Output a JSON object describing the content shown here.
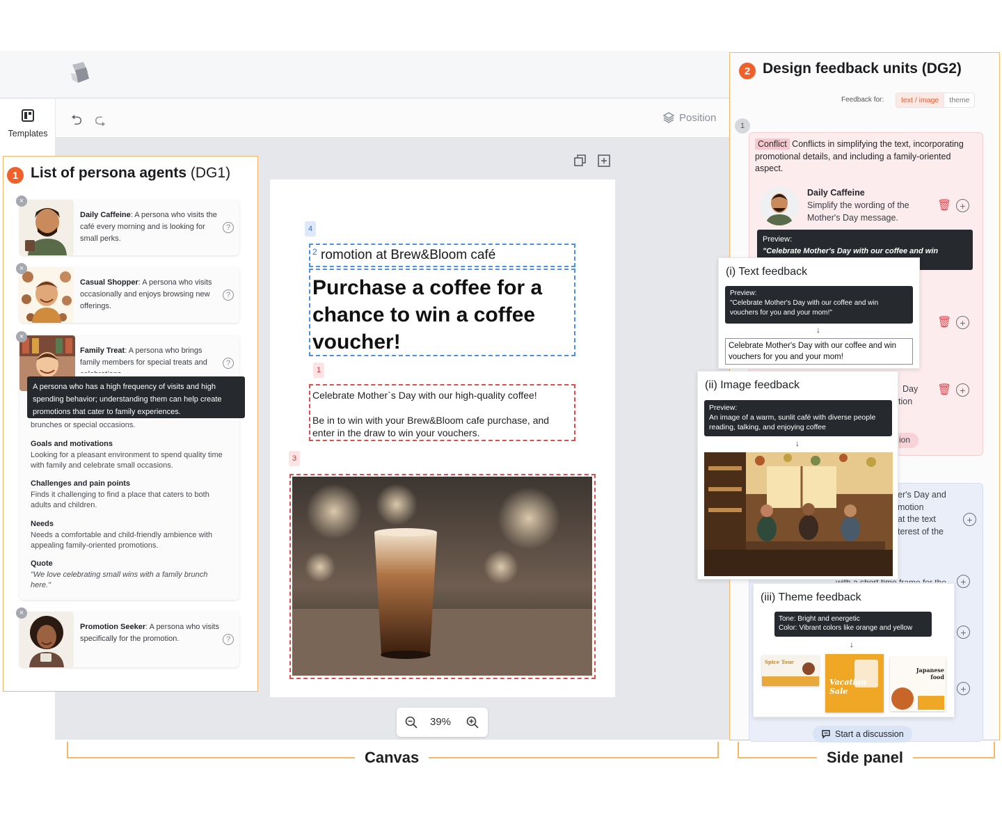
{
  "left_rail": {
    "templates_label": "Templates"
  },
  "toolbar": {
    "position_label": "Position"
  },
  "personas_panel": {
    "number": "1",
    "title": "List of persona agents",
    "title_suffix": "(DG1)",
    "personas": [
      {
        "name": "Daily Caffeine",
        "desc_lines": [
          "A persona who",
          "visits the café every morning and is",
          "looking for small perks."
        ]
      },
      {
        "name": "Casual Shopper",
        "desc_lines": [
          "A persona who",
          "visits occasionally and enjoys",
          "browsing new offerings."
        ]
      },
      {
        "name": "Family Treat",
        "desc_lines": [
          "A persona who",
          "brings family members for special",
          "treats and celebrations."
        ]
      },
      {
        "name": "Promotion Seeker",
        "desc_lines": [
          "A persona who",
          "visits specifically for the",
          "promotion."
        ]
      }
    ],
    "tooltip": "A persona who has a high frequency of visits and high spending behavior; understanding them can help create promotions that cater to family experiences.",
    "detail": {
      "intro_tail": "brunches or special occasions.",
      "sections": [
        {
          "heading": "Goals and motivations",
          "text": "Looking for a pleasant environment to spend quality time with family and celebrate small occasions."
        },
        {
          "heading": "Challenges and pain points",
          "text": "Finds it challenging to find a place that caters to both adults and children."
        },
        {
          "heading": "Needs",
          "text": "Needs a comfortable and child-friendly ambience with appealing family-oriented promotions."
        },
        {
          "heading": "Quote",
          "text": "\"We love celebrating small wins with a family brunch here.\""
        }
      ]
    }
  },
  "canvas": {
    "tags": {
      "t4": "4",
      "t2": "2",
      "t1": "1",
      "t3": "3"
    },
    "subtitle": "romotion at Brew&Bloom café",
    "headline": "Purchase a coffee for a chance to win a coffee voucher!",
    "body_line1": "Celebrate Mother`s Day with our high-quality coffee!",
    "body_line2": "Be in to win with your Brew&Bloom cafe purchase, and enter in the draw to win your vouchers.",
    "zoom": "39%"
  },
  "side_panel": {
    "number": "2",
    "title": "Design feedback units (DG2)",
    "feedback_for_label": "Feedback for:",
    "seg_options": [
      "text / image",
      "theme"
    ],
    "seg_selected": "text / image",
    "unit_number": "1",
    "conflict_badge": "Conflict",
    "conflict_text": "Conflicts in simplifying the text, incorporating promotional details, and including a family-oriented aspect.",
    "item_name": "Daily Caffeine",
    "item_text": "Simplify the wording of the Mother's Day message.",
    "preview_label": "Preview:",
    "preview_text": "\"Celebrate Mother's Day with our coffee and win",
    "frag_day": "Day",
    "frag_tion": "tion",
    "frag_ion": "ion",
    "frag_lines": [
      "er's Day and",
      "motion",
      "at the text",
      "terest of the"
    ],
    "frag_bottom": "with a short time frame for the",
    "start_discussion": "Start a discussion"
  },
  "popups": {
    "text_fb": {
      "title": "(i) Text feedback",
      "preview_label": "Preview:",
      "preview_text": "\"Celebrate Mother's Day with our coffee and win vouchers for you and your mom!\"",
      "result": "Celebrate Mother's Day with our coffee and win vouchers for you and your mom!"
    },
    "image_fb": {
      "title": "(ii) Image feedback",
      "preview_label": "Preview:",
      "preview_text": "An image of a warm, sunlit café with diverse people reading, talking, and enjoying coffee"
    },
    "theme_fb": {
      "title": "(iii) Theme feedback",
      "tone": "Tone: Bright and energetic",
      "color": "Color: Vibrant colors like orange and yellow",
      "thumb1": "Spice Tour",
      "thumb2": "Vacation Sale",
      "thumb3": "Japanese food"
    }
  },
  "labels": {
    "canvas": "Canvas",
    "side_panel": "Side panel"
  }
}
